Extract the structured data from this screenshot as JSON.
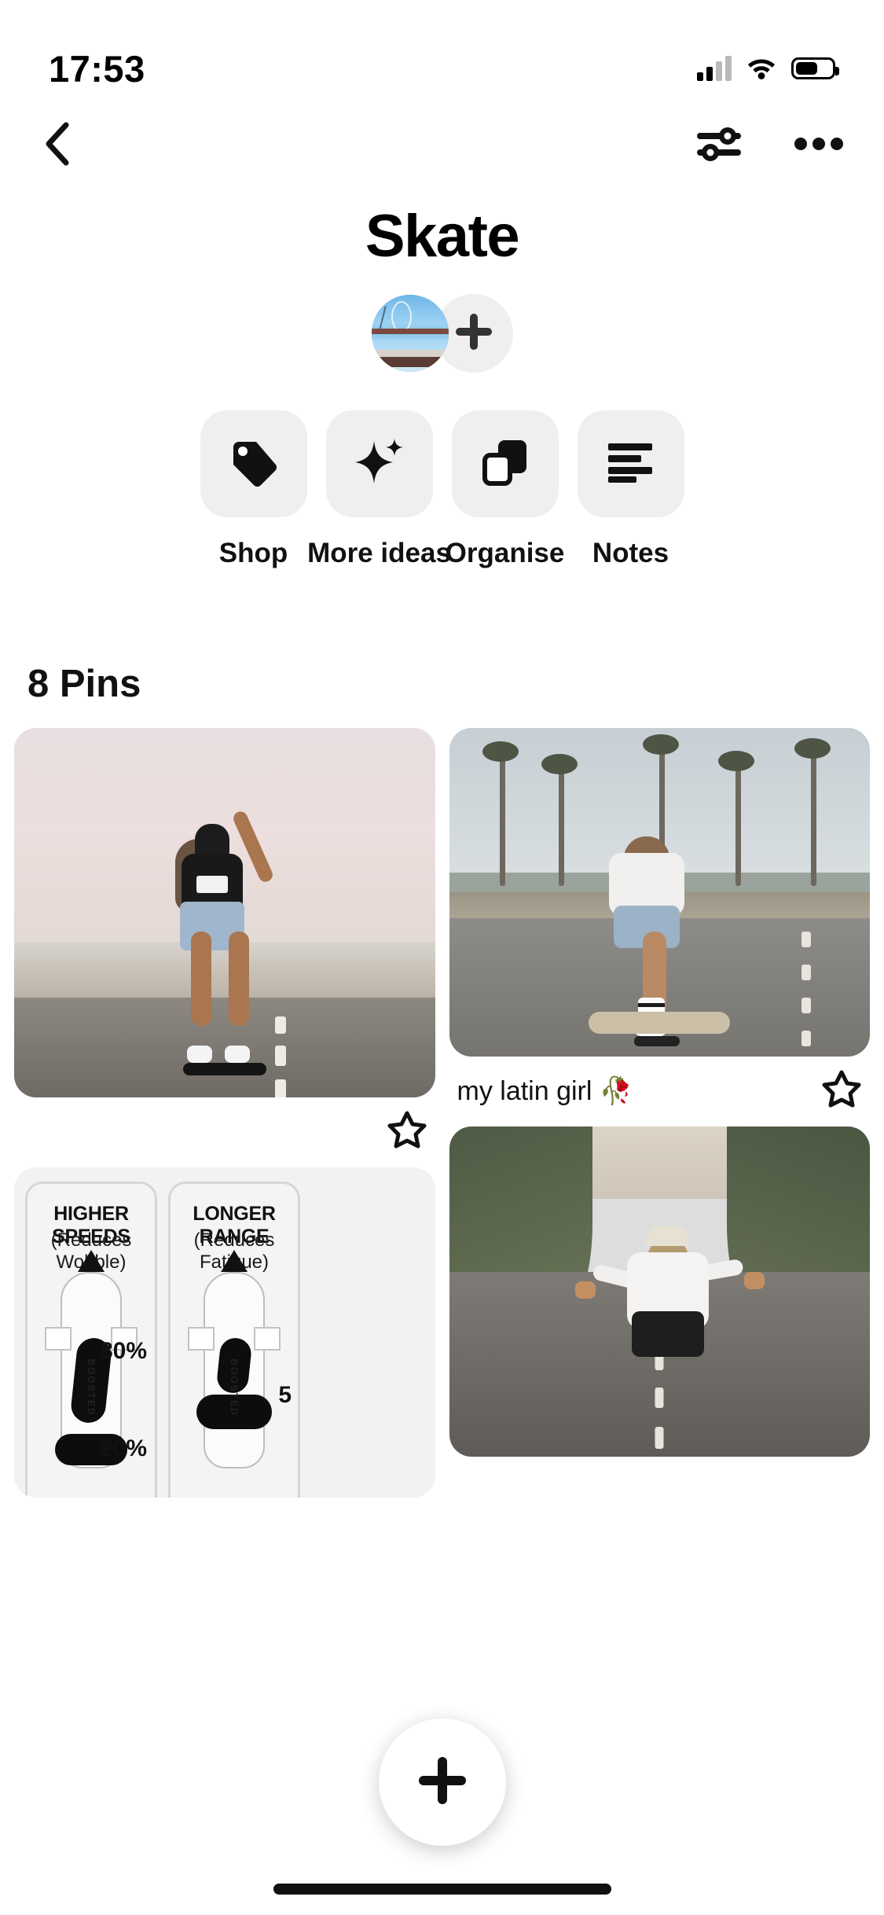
{
  "status_bar": {
    "time": "17:53",
    "signal_icon": "signal-bars-icon",
    "wifi_icon": "wifi-icon",
    "battery_icon": "battery-icon"
  },
  "nav": {
    "back_icon": "back-chevron-icon",
    "filter_icon": "sliders-filter-icon",
    "more_icon": "more-horizontal-icon"
  },
  "board": {
    "title": "Skate",
    "collaborator_avatar": "board-owner-avatar",
    "add_collaborator_icon": "plus-icon"
  },
  "actions": [
    {
      "label": "Shop",
      "icon": "price-tag-icon"
    },
    {
      "label": "More ideas",
      "icon": "sparkle-icon"
    },
    {
      "label": "Organise",
      "icon": "overlapping-squares-icon"
    },
    {
      "label": "Notes",
      "icon": "text-lines-icon"
    }
  ],
  "pins_section": {
    "count_label": "8 Pins"
  },
  "pins": [
    {
      "id": "pin-1",
      "alt": "Woman in adidas crop top riding longboard on beach road",
      "caption": "",
      "save_icon": "star-outline-icon"
    },
    {
      "id": "pin-2",
      "alt": "Woman skateboarding on palm tree lined road",
      "caption": "my latin girl 🥀",
      "save_icon": "star-outline-icon"
    },
    {
      "id": "pin-3",
      "alt": "Boosted board foot placement infographic",
      "caption": "",
      "save_icon": "star-outline-icon",
      "infographic": {
        "panels": [
          {
            "title": "HIGHER SPEEDS",
            "subtitle": "(Reduces Wobble)",
            "front_pct": "80%",
            "rear_pct": "20%",
            "brand": "BOOSTED"
          },
          {
            "title": "LONGER RANGE",
            "subtitle": "(Reduces Fatigue)",
            "front_pct": "",
            "rear_pct": "5",
            "brand": "BOOSTED"
          }
        ]
      }
    },
    {
      "id": "pin-4",
      "alt": "Woman longboarding downhill on tree lined road",
      "caption": "",
      "save_icon": "star-outline-icon"
    }
  ],
  "fab": {
    "icon": "plus-icon",
    "label": "Create"
  },
  "colors": {
    "background": "#ffffff",
    "tile_gray": "#efefef",
    "text_primary": "#111111",
    "accent_black": "#000000"
  }
}
